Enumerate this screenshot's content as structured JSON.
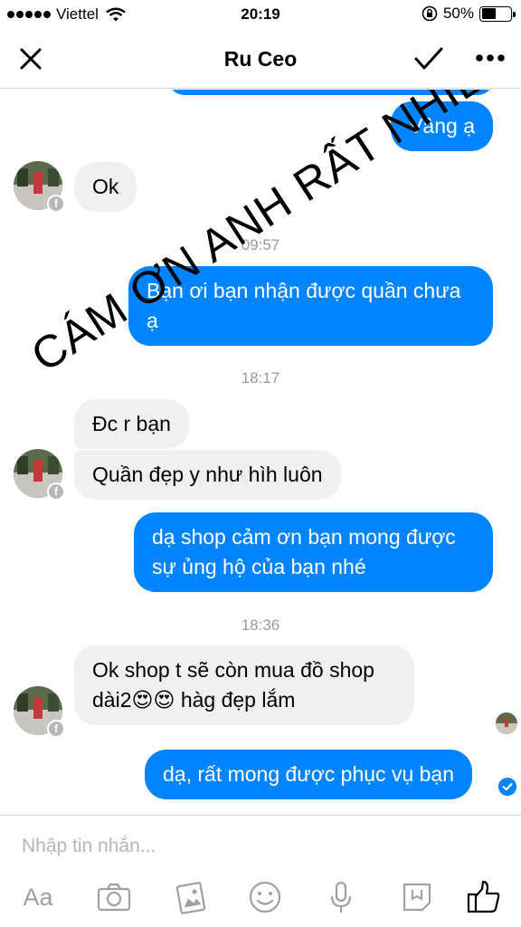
{
  "status_bar": {
    "carrier": "Viettel",
    "time": "20:19",
    "battery": "50%",
    "battery_level": 0.5
  },
  "header": {
    "title": "Ru Ceo"
  },
  "messages": [
    {
      "dir": "out",
      "text": "Vâng ạ"
    },
    {
      "dir": "in",
      "text": "Ok"
    },
    {
      "type": "time",
      "text": "09:57"
    },
    {
      "dir": "out",
      "text": "Bạn ơi bạn nhận được quần chưa ạ"
    },
    {
      "type": "time",
      "text": "18:17"
    },
    {
      "dir": "in",
      "text": "Đc r bạn"
    },
    {
      "dir": "in",
      "text": "Quần đẹp y như hìh luôn"
    },
    {
      "dir": "out",
      "text": "dạ shop cảm ơn bạn mong được sự ủng hộ của bạn nhé"
    },
    {
      "type": "time",
      "text": "18:36"
    },
    {
      "dir": "in",
      "text": "Ok shop t sẽ còn mua đồ shop dài2😍😍 hàg đẹp lắm"
    },
    {
      "dir": "out",
      "text": "dạ, rất mong được phục vụ bạn"
    }
  ],
  "watermark": "CÁM ƠN ANH RẤT NHIỀU",
  "composer": {
    "placeholder": "Nhập tin nhắn...",
    "aa_label": "Aa"
  },
  "icons": [
    "close-icon",
    "checkmark-icon",
    "more-icon",
    "camera-icon",
    "gallery-icon",
    "emoji-icon",
    "microphone-icon",
    "sticker-icon",
    "like-icon"
  ],
  "colors": {
    "outgoing_bubble": "#0084ff",
    "incoming_bubble": "#f1f0f0",
    "toolbar_icon": "#a0a0a0"
  }
}
